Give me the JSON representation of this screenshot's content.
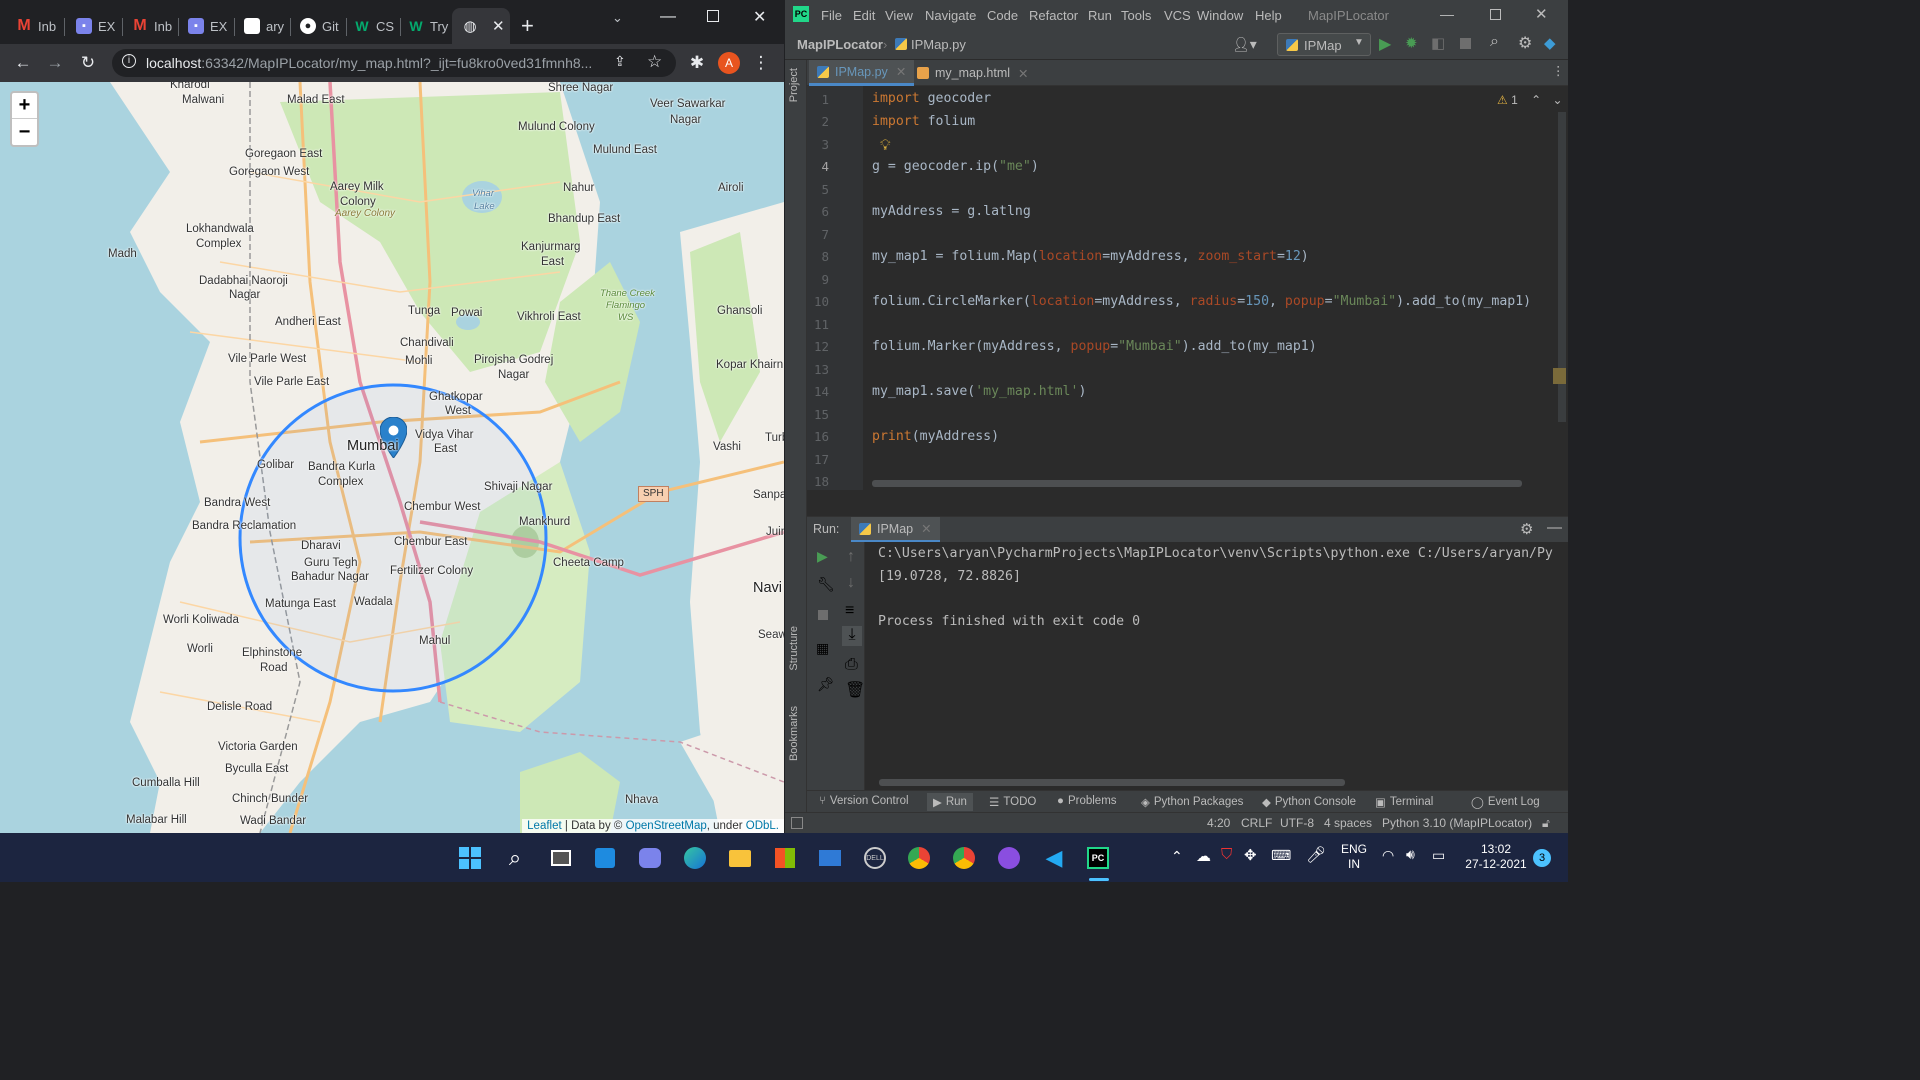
{
  "browser": {
    "tabs": [
      {
        "label": "Inb",
        "icon": "gmail-icon",
        "color": "#ea4335"
      },
      {
        "label": "EX",
        "icon": "teams-icon",
        "color": "#7b83eb"
      },
      {
        "label": "Inb",
        "icon": "gmail-icon",
        "color": "#ea4335"
      },
      {
        "label": "EX",
        "icon": "teams-icon",
        "color": "#7b83eb"
      },
      {
        "label": "ary",
        "icon": "doc-icon",
        "color": "#ffffff"
      },
      {
        "label": "Git",
        "icon": "github-icon",
        "color": "#ffffff"
      },
      {
        "label": "CS",
        "icon": "w3schools-icon",
        "color": "#04aa6d"
      },
      {
        "label": "Try",
        "icon": "w3schools-icon",
        "color": "#04aa6d"
      },
      {
        "label": "",
        "icon": "globe-icon",
        "color": "#ffffff",
        "active": true
      }
    ],
    "new_tab": "+",
    "url_host": "localhost",
    "url_rest": ":63342/MapIPLocator/my_map.html?_ijt=fu8kro0ved31fmnh8...",
    "profile_initial": "A"
  },
  "map": {
    "zoom_in": "+",
    "zoom_out": "−",
    "labels": {
      "malwani": "Malwani",
      "malad_east": "Malad East",
      "shree_nagar": "Shree Nagar",
      "veer_sawarkar": "Veer Sawarkar",
      "nagar1": "Nagar",
      "mulund_colony": "Mulund Colony",
      "mulund_east": "Mulund East",
      "goregaon_east": "Goregaon East",
      "goregaon_west": "Goregaon West",
      "aarey_milk": "Aarey Milk",
      "colony": "Colony",
      "aarey_colony": "Aarey Colony",
      "vihar_lake": "Vihar",
      "lake": "Lake",
      "nahur": "Nahur",
      "airoli": "Airoli",
      "lokhandwala": "Lokhandwala",
      "complex": "Complex",
      "bhandup_east": "Bhandup East",
      "kanjurmarg": "Kanjurmarg",
      "east": "East",
      "madh": "Madh",
      "dadabhai_naoroji": "Dadabhai Naoroji",
      "nagar2": "Nagar",
      "thane_creek": "Thane Creek",
      "flamingo": "Flamingo",
      "ws": "WS",
      "andheri_east": "Andheri East",
      "tunga": "Tunga",
      "powai": "Powai",
      "vikhroli_east": "Vikhroli East",
      "ghansoli": "Ghansoli",
      "chandivali": "Chandivali",
      "vile_parle_west": "Vile Parle West",
      "mohli": "Mohli",
      "pirojsha_godrej": "Pirojsha Godrej",
      "nagar3": "Nagar",
      "kopar_khairne": "Kopar Khairn",
      "vile_parle_east": "Vile Parle East",
      "ghatkopar": "Ghatkopar",
      "west": "West",
      "mumbai": "Mumbai",
      "vidya_vihar": "Vidya Vihar",
      "east2": "East",
      "vashi": "Vashi",
      "turb": "Turb",
      "golibar": "Golibar",
      "bandra_kurla": "Bandra Kurla",
      "complex2": "Complex",
      "shivaji_nagar": "Shivaji Nagar",
      "sph": "SPH",
      "sanpada": "Sanpa",
      "bandra_west": "Bandra West",
      "chembur_west": "Chembur West",
      "mankhurd": "Mankhurd",
      "juin": "Juin",
      "bandra_reclamation": "Bandra Reclamation",
      "dharavi": "Dharavi",
      "chembur_east": "Chembur East",
      "cheeta_camp": "Cheeta Camp",
      "guru_tegh": "Guru Tegh",
      "bahadur_nagar": "Bahadur Nagar",
      "fertilizer_colony": "Fertilizer Colony",
      "navi": "Navi",
      "matunga_east": "Matunga East",
      "wadala": "Wadala",
      "worli_koliwada": "Worli Koliwada",
      "mahul": "Mahul",
      "seaw": "Seaw",
      "worli": "Worli",
      "elphinstone": "Elphinstone",
      "road": "Road",
      "delisle_road": "Delisle Road",
      "victoria_garden": "Victoria Garden",
      "byculla_east": "Byculla East",
      "cumballa_hill": "Cumballa Hill",
      "chinch_bunder": "Chinch Bunder",
      "nhava": "Nhava",
      "malabar_hill": "Malabar Hill",
      "wadi_bandar": "Wadi Bandar",
      "khar": "Kharodi"
    },
    "attribution": {
      "leaflet": "Leaflet",
      "data_by": " | Data by © ",
      "osm": "OpenStreetMap",
      "under": ", under ",
      "odbl": "ODbL."
    }
  },
  "ide": {
    "menus": [
      "File",
      "Edit",
      "View",
      "Navigate",
      "Code",
      "Refactor",
      "Run",
      "Tools",
      "VCS",
      "Window",
      "Help"
    ],
    "project_title": "MapIPLocator",
    "breadcrumb_project": "MapIPLocator",
    "breadcrumb_file": "IPMap.py",
    "run_config": "IPMap",
    "tabs": [
      {
        "label": "IPMap.py",
        "active": true
      },
      {
        "label": "my_map.html",
        "active": false
      }
    ],
    "warning_count": "1",
    "sidebar_project": "Project",
    "sidebar_structure": "Structure",
    "sidebar_bookmarks": "Bookmarks",
    "line_numbers": [
      "1",
      "2",
      "3",
      "4",
      "5",
      "6",
      "7",
      "8",
      "9",
      "10",
      "11",
      "12",
      "13",
      "14",
      "15",
      "16",
      "17",
      "18"
    ],
    "run_label": "Run:",
    "run_tab": "IPMap",
    "console_lines": [
      "C:\\Users\\aryan\\PycharmProjects\\MapIPLocator\\venv\\Scripts\\python.exe C:/Users/aryan/Py",
      "[19.0728, 72.8826]",
      "",
      "Process finished with exit code 0"
    ],
    "bottom_tabs": [
      "Version Control",
      "Run",
      "TODO",
      "Problems",
      "Python Packages",
      "Python Console",
      "Terminal",
      "Event Log"
    ],
    "status": {
      "position": "4:20",
      "line_sep": "CRLF",
      "encoding": "UTF-8",
      "indent": "4 spaces",
      "interpreter": "Python 3.10 (MapIPLocator)"
    }
  },
  "taskbar": {
    "lang": "ENG",
    "region": "IN",
    "time": "13:02",
    "date": "27-12-2021",
    "notifications": "3"
  }
}
